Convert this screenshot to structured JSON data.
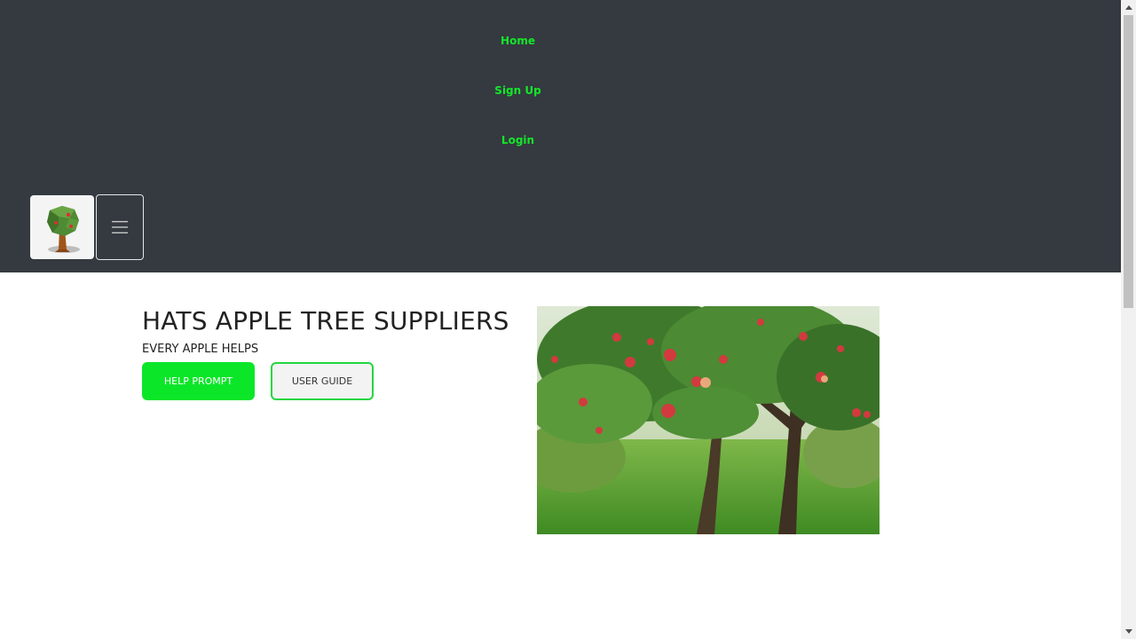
{
  "nav": {
    "home": "Home",
    "signup": "Sign Up",
    "login": "Login"
  },
  "hero": {
    "title": "HATS APPLE TREE SUPPLIERS",
    "subtitle": "EVERY APPLE HELPS",
    "help_button": "HELP PROMPT",
    "guide_button": "USER GUIDE"
  },
  "icons": {
    "logo": "apple-tree-icon",
    "menu": "hamburger-menu-icon"
  },
  "colors": {
    "header_bg": "#343a40",
    "nav_link": "#14e629",
    "accent_green": "#0be629"
  }
}
